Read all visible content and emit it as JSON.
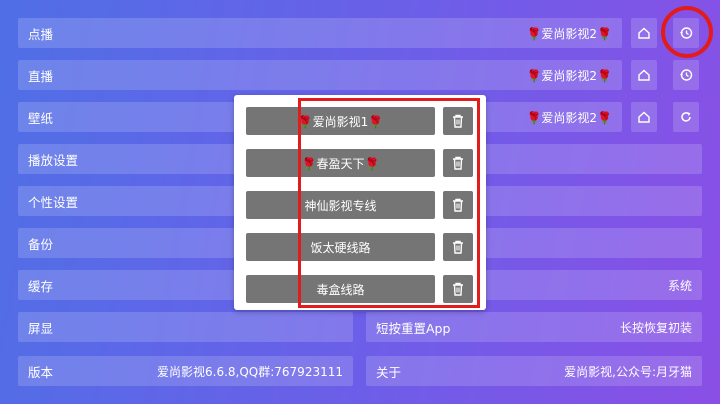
{
  "settings": {
    "rows": [
      {
        "label": "点播",
        "value": "🌹爱尚影视2🌹"
      },
      {
        "label": "直播",
        "value": "🌹爱尚影视2🌹"
      },
      {
        "label": "壁纸",
        "value": "🌹爱尚影视2🌹"
      },
      {
        "label": "播放设置",
        "value": ""
      },
      {
        "label": "个性设置",
        "value": ""
      },
      {
        "label": "备份",
        "value": ""
      },
      {
        "label": "缓存",
        "value": "系统"
      }
    ],
    "screen": {
      "label": "屏显"
    },
    "reset": {
      "label": "短按重置App",
      "value": "长按恢复初装"
    },
    "version": {
      "label": "版本",
      "value": "爱尚影视6.6.8,QQ群:767923111"
    },
    "about": {
      "label": "关于",
      "value": "爱尚影视,公众号:月牙猫"
    }
  },
  "icons": {
    "home": "home-icon",
    "history": "history-icon",
    "refresh": "refresh-icon",
    "delete": "trash-icon"
  },
  "dialog": {
    "items": [
      {
        "label": "🌹爱尚影视1🌹"
      },
      {
        "label": "🌹春盈天下🌹"
      },
      {
        "label": "神仙影视专线"
      },
      {
        "label": "饭太硬线路"
      },
      {
        "label": "毒盒线路"
      }
    ]
  },
  "colors": {
    "annotation": "#e21c1c",
    "item_bg": "#757575"
  }
}
